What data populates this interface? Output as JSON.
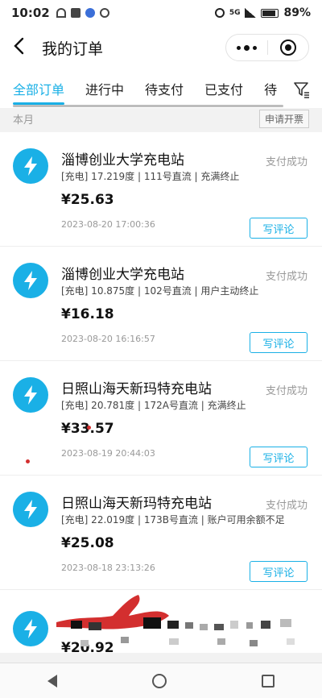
{
  "status_bar": {
    "time": "10:02",
    "battery": "89%",
    "signal_label": "5G"
  },
  "navbar": {
    "title": "我的订单",
    "back_icon": "chevron-left-icon",
    "more_icon": "more-dots-icon",
    "close_icon": "target-icon"
  },
  "tabs": [
    {
      "label": "全部订单",
      "active": true
    },
    {
      "label": "进行中",
      "active": false
    },
    {
      "label": "待支付",
      "active": false
    },
    {
      "label": "已支付",
      "active": false
    },
    {
      "label": "待",
      "active": false
    }
  ],
  "month_row": {
    "month": "本月",
    "invoice_button": "申请开票"
  },
  "orders": [
    {
      "station": "淄博创业大学充电站",
      "status": "支付成功",
      "detail": "[充电] 17.219度 | 111号直流 | 充满终止",
      "price": "¥25.63",
      "time": "2023-08-20 17:00:36",
      "review_button": "写评论"
    },
    {
      "station": "淄博创业大学充电站",
      "status": "支付成功",
      "detail": "[充电] 10.875度 | 102号直流 | 用户主动终止",
      "price": "¥16.18",
      "time": "2023-08-20 16:16:57",
      "review_button": "写评论"
    },
    {
      "station": "日照山海天新玛特充电站",
      "status": "支付成功",
      "detail": "[充电] 20.781度 | 172A号直流 | 充满终止",
      "price": "¥33.57",
      "time": "2023-08-19 20:44:03",
      "review_button": "写评论"
    },
    {
      "station": "日照山海天新玛特充电站",
      "status": "支付成功",
      "detail": "[充电] 22.019度 | 173B号直流 | 账户可用余额不足",
      "price": "¥25.08",
      "time": "2023-08-18 23:13:26",
      "review_button": "写评论"
    }
  ],
  "partial_order": {
    "price": "¥20.92"
  },
  "colors": {
    "accent": "#1ab0e6",
    "redaction": "#d32f2f"
  }
}
